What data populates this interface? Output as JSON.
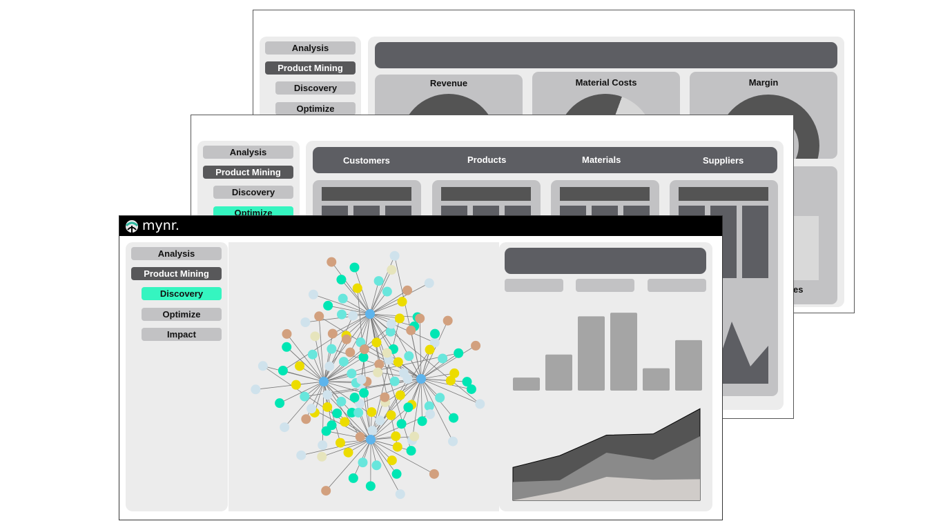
{
  "back_window": {
    "nav": [
      {
        "label": "Analysis",
        "state": "default"
      },
      {
        "label": "Product Mining",
        "state": "parent"
      },
      {
        "label": "Discovery",
        "state": "default"
      },
      {
        "label": "Optimize",
        "state": "default"
      }
    ],
    "cards": [
      {
        "title": "Revenue"
      },
      {
        "title": "Material Costs"
      },
      {
        "title": "Margin"
      }
    ],
    "partial_label": "es"
  },
  "middle_window": {
    "nav": [
      {
        "label": "Analysis",
        "state": "default"
      },
      {
        "label": "Product Mining",
        "state": "parent"
      },
      {
        "label": "Discovery",
        "state": "default"
      },
      {
        "label": "Optimize",
        "state": "active"
      }
    ],
    "tabs": [
      {
        "label": "Customers"
      },
      {
        "label": "Products"
      },
      {
        "label": "Materials"
      },
      {
        "label": "Suppliers"
      }
    ]
  },
  "front_window": {
    "brand": "mynr.",
    "logo_icon": "mynr-logo-icon",
    "nav": [
      {
        "label": "Analysis",
        "state": "default"
      },
      {
        "label": "Product Mining",
        "state": "parent"
      },
      {
        "label": "Discovery",
        "state": "active"
      },
      {
        "label": "Optimize",
        "state": "default"
      },
      {
        "label": "Impact",
        "state": "default"
      }
    ],
    "colors": {
      "accent": "#35f5c0",
      "hub": "#5db4ec",
      "teal": "#00e6b4",
      "aqua": "#68e6dc",
      "yellow": "#ecdc00",
      "tan": "#d2a07e",
      "pale": "#e6e4bc",
      "light": "#cfe2ec"
    },
    "bar_chart": {
      "values": [
        18,
        50,
        103,
        108,
        31,
        70
      ]
    },
    "area_chart": {
      "x": [
        0,
        1,
        2,
        3,
        4
      ],
      "series": [
        {
          "name": "bottom",
          "values": [
            0,
            15,
            40,
            35,
            36
          ]
        },
        {
          "name": "middle",
          "values": [
            10,
            13,
            60,
            48,
            88
          ]
        },
        {
          "name": "top",
          "values": [
            35,
            55,
            90,
            92,
            135
          ]
        }
      ]
    }
  }
}
